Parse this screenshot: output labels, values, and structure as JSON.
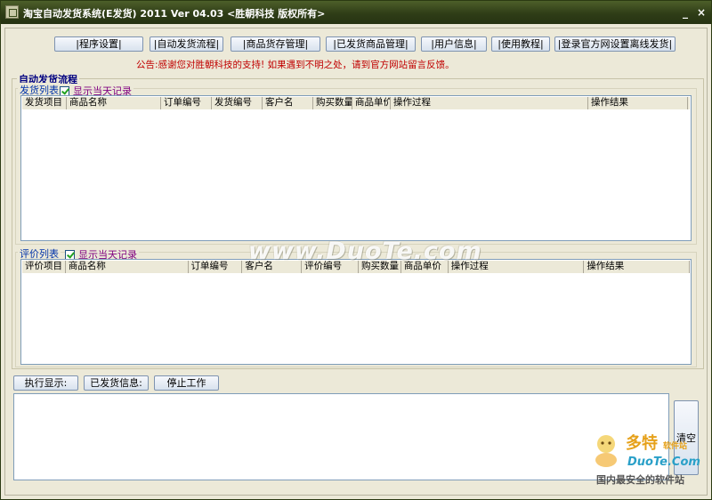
{
  "window": {
    "title": "淘宝自动发货系统(E发货) 2011 Ver 04.03 <胜朝科技 版权所有>",
    "minimize": "_",
    "close": "×"
  },
  "toolbar": [
    {
      "label": "|程序设置|"
    },
    {
      "label": "|自动发货流程|"
    },
    {
      "label": "|商品货存管理|"
    },
    {
      "label": "|已发货商品管理|"
    },
    {
      "label": "|用户信息|"
    },
    {
      "label": "|使用教程|"
    },
    {
      "label": "|登录官方网设置离线发货|"
    }
  ],
  "notice": "公告:感谢您对胜朝科技的支持! 如果遇到不明之处，请到官方网站留言反馈。",
  "flow_group": {
    "title": "自动发货流程"
  },
  "shipping": {
    "title": "发货列表",
    "checkbox_label": "显示当天记录",
    "checked": true,
    "columns": [
      "发货项目",
      "商品名称",
      "订单编号",
      "发货编号",
      "客户名",
      "购买数量",
      "商品单价",
      "操作过程",
      "操作结果"
    ]
  },
  "review": {
    "title": "评价列表",
    "checkbox_label": "显示当天记录",
    "checked": true,
    "columns": [
      "评价项目",
      "商品名称",
      "订单编号",
      "客户名",
      "评价编号",
      "购买数量",
      "商品单价",
      "操作过程",
      "操作结果"
    ]
  },
  "actions": {
    "execute": "执行显示:",
    "shipped_info": "已发货信息:",
    "stop": "停止工作",
    "clear": "清空"
  },
  "watermark": {
    "center": "www.DuoTe.com",
    "brand": "多特",
    "brand_sub": "软件站",
    "url": "DuoTe.Com",
    "slogan": "国内最安全的软件站"
  }
}
